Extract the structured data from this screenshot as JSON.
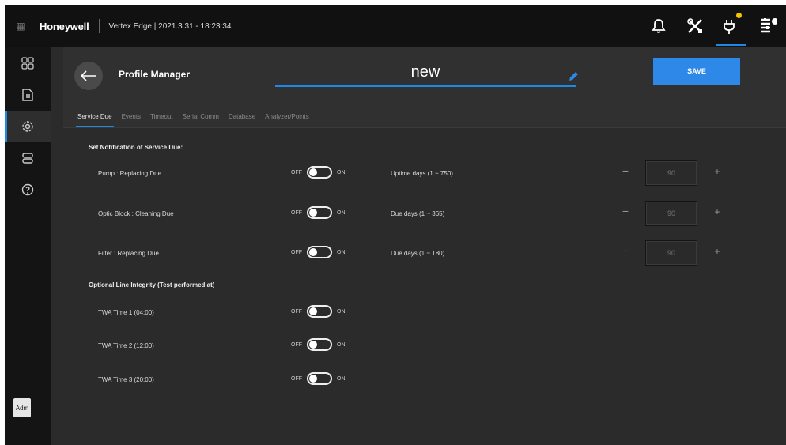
{
  "app": {
    "brand": "Honeywell",
    "title": "Vertex Edge | 2021.3.31 - 18:23:34"
  },
  "topbar_icons": [
    "bell-icon",
    "tools-icon",
    "plug-icon",
    "list-settings-icon"
  ],
  "sidebar": {
    "items": [
      "dashboard-icon",
      "document-icon",
      "settings-icon",
      "servers-icon",
      "help-icon"
    ],
    "user_badge": "Adm"
  },
  "header": {
    "title": "Profile Manager",
    "profile_name": "new",
    "save_label": "SAVE"
  },
  "tabs": [
    "Service Due",
    "Events",
    "Timeout",
    "Serial Comm",
    "Database",
    "Analyzer/Points"
  ],
  "service_due": {
    "section_title": "Set Notification of Service Due:",
    "toggle_off": "OFF",
    "toggle_on": "ON",
    "rows": [
      {
        "label": "Pump : Replacing Due",
        "range_label": "Uptime days (1 ~ 750)",
        "value": "90",
        "minus": "−",
        "plus": "+"
      },
      {
        "label": "Optic Block : Cleaning Due",
        "range_label": "Due days (1 ~ 365)",
        "value": "90",
        "minus": "−",
        "plus": "+"
      },
      {
        "label": "Filter : Replacing Due",
        "range_label": "Due days (1 ~ 180)",
        "value": "90",
        "minus": "−",
        "plus": "+"
      }
    ]
  },
  "line_integrity": {
    "section_title": "Optional Line Integrity (Test performed at)",
    "rows": [
      {
        "label": "TWA Time 1 (04:00)"
      },
      {
        "label": "TWA Time 2 (12:00)"
      },
      {
        "label": "TWA Time 3 (20:00)"
      }
    ]
  },
  "colors": {
    "accent": "#1e88e5",
    "save_button": "#2e88e8",
    "notification_dot": "#f5c400",
    "background": "#2b2b2b",
    "topbar": "#111111"
  }
}
